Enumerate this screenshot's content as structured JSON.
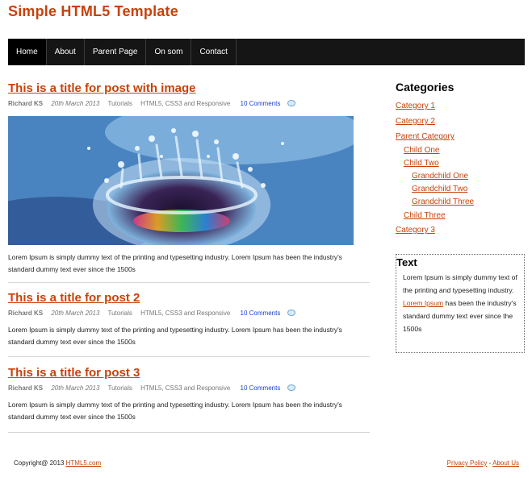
{
  "site": {
    "title": "Simple HTML5 Template"
  },
  "nav": {
    "items": [
      {
        "label": "Home"
      },
      {
        "label": "About"
      },
      {
        "label": "Parent Page"
      },
      {
        "label": "On som"
      },
      {
        "label": "Contact"
      }
    ]
  },
  "posts": [
    {
      "title": "This is a title for post with image",
      "author": "Richard KS",
      "date": "20th March 2013",
      "category": "Tutorials",
      "tags": "HTML5, CSS3 and Responsive",
      "comments": "10 Comments",
      "excerpt": "Lorem Ipsum is simply dummy text of the printing and typesetting industry. Lorem Ipsum has been the industry's standard dummy text ever since the 1500s"
    },
    {
      "title": "This is a title for post 2",
      "author": "Richard KS",
      "date": "20th March 2013",
      "category": "Tutorials",
      "tags": "HTML5, CSS3 and Responsive",
      "comments": "10 Comments",
      "excerpt": "Lorem Ipsum is simply dummy text of the printing and typesetting industry. Lorem Ipsum has been the industry's standard dummy text ever since the 1500s"
    },
    {
      "title": "This is a title for post 3",
      "author": "Richard KS",
      "date": "20th March 2013",
      "category": "Tutorials",
      "tags": "HTML5, CSS3 and Responsive",
      "comments": "10 Comments",
      "excerpt": "Lorem Ipsum is simply dummy text of the printing and typesetting industry. Lorem Ipsum has been the industry's standard dummy text ever since the 1500s"
    }
  ],
  "sidebar": {
    "categories_heading": "Categories",
    "categories": [
      {
        "label": "Category 1"
      },
      {
        "label": "Category 2"
      },
      {
        "label": "Parent Category"
      },
      {
        "label": "Child One"
      },
      {
        "label": "Child Two"
      },
      {
        "label": "Grandchild One"
      },
      {
        "label": "Grandchild Two"
      },
      {
        "label": "Grandchild Three"
      },
      {
        "label": "Child Three"
      },
      {
        "label": "Category 3"
      }
    ],
    "text_heading": "Text",
    "text_before": "Lorem Ipsum is simply dummy text of the printing and typesetting industry. ",
    "text_link": "Lorem Ipsum",
    "text_after": " has been the industry's standard dummy text ever since the 1500s"
  },
  "footer": {
    "copyright": "Copyright@ 2013 ",
    "copyright_link": "HTML5.com",
    "privacy": "Privacy Policy",
    "separator": " - ",
    "about": "About Us"
  },
  "colors": {
    "accent": "#c7420a",
    "nav_bg": "#151515",
    "comment_link": "#1a3fd0"
  }
}
